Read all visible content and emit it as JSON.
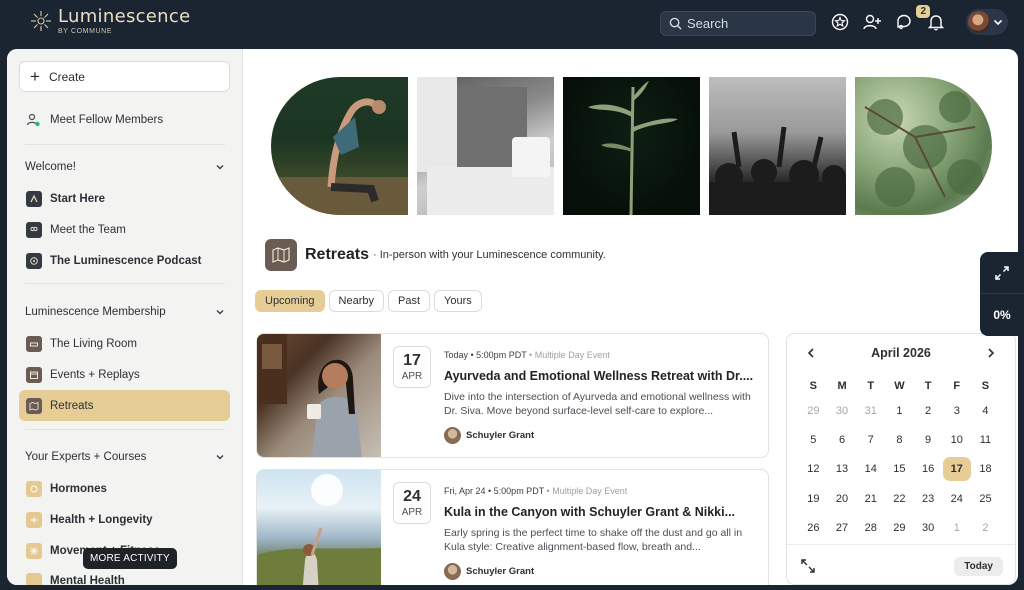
{
  "brand": {
    "name": "Luminescence",
    "sub": "BY COMMUNE"
  },
  "search": {
    "label": "Search"
  },
  "topbar": {
    "messages_badge": "2"
  },
  "sidebar": {
    "create_label": "Create",
    "meet_members": "Meet Fellow Members",
    "section_welcome": "Welcome!",
    "welcome_items": [
      "Start Here",
      "Meet the Team",
      "The Luminescence Podcast"
    ],
    "section_membership": "Luminescence Membership",
    "membership_items": [
      "The Living Room",
      "Events + Replays",
      "Retreats"
    ],
    "section_experts": "Your Experts + Courses",
    "expert_items": [
      "Hormones",
      "Health + Longevity",
      "Movement + Fitness",
      "Mental Health"
    ],
    "tooltip": "MORE ACTIVITY"
  },
  "retreats": {
    "title": "Retreats",
    "subtitle": "· In-person with your Luminescence community.",
    "tabs": [
      "Upcoming",
      "Nearby",
      "Past",
      "Yours"
    ]
  },
  "events": [
    {
      "day": "17",
      "month": "APR",
      "meta": "Today • 5:00pm PDT",
      "tag": "• Multiple Day Event",
      "title": "Ayurveda and Emotional Wellness Retreat with Dr....",
      "desc": "Dive into the intersection of Ayurveda and emotional wellness with Dr. Siva. Move beyond surface-level self-care to explore...",
      "host": "Schuyler Grant"
    },
    {
      "day": "24",
      "month": "APR",
      "meta": "Fri, Apr 24 • 5:00pm PDT",
      "tag": "• Multiple Day Event",
      "title": "Kula in the Canyon with Schuyler Grant & Nikki...",
      "desc": "Early spring is the perfect time to shake off the dust and go all in Kula style: Creative alignment-based flow, breath and...",
      "host": "Schuyler Grant"
    }
  ],
  "calendar": {
    "month": "April 2026",
    "dow": [
      "S",
      "M",
      "T",
      "W",
      "T",
      "F",
      "S"
    ],
    "weeks": [
      [
        "29",
        "30",
        "31",
        "1",
        "2",
        "3",
        "4"
      ],
      [
        "5",
        "6",
        "7",
        "8",
        "9",
        "10",
        "11"
      ],
      [
        "12",
        "13",
        "14",
        "15",
        "16",
        "17",
        "18"
      ],
      [
        "19",
        "20",
        "21",
        "22",
        "23",
        "24",
        "25"
      ],
      [
        "26",
        "27",
        "28",
        "29",
        "30",
        "1",
        "2"
      ]
    ],
    "selected": "17",
    "today_label": "Today"
  },
  "widget": {
    "progress": "0%"
  },
  "colors": {
    "accent": "#e6cd96",
    "topbar": "#1b2431",
    "sidebar": "#f3f3f1"
  }
}
